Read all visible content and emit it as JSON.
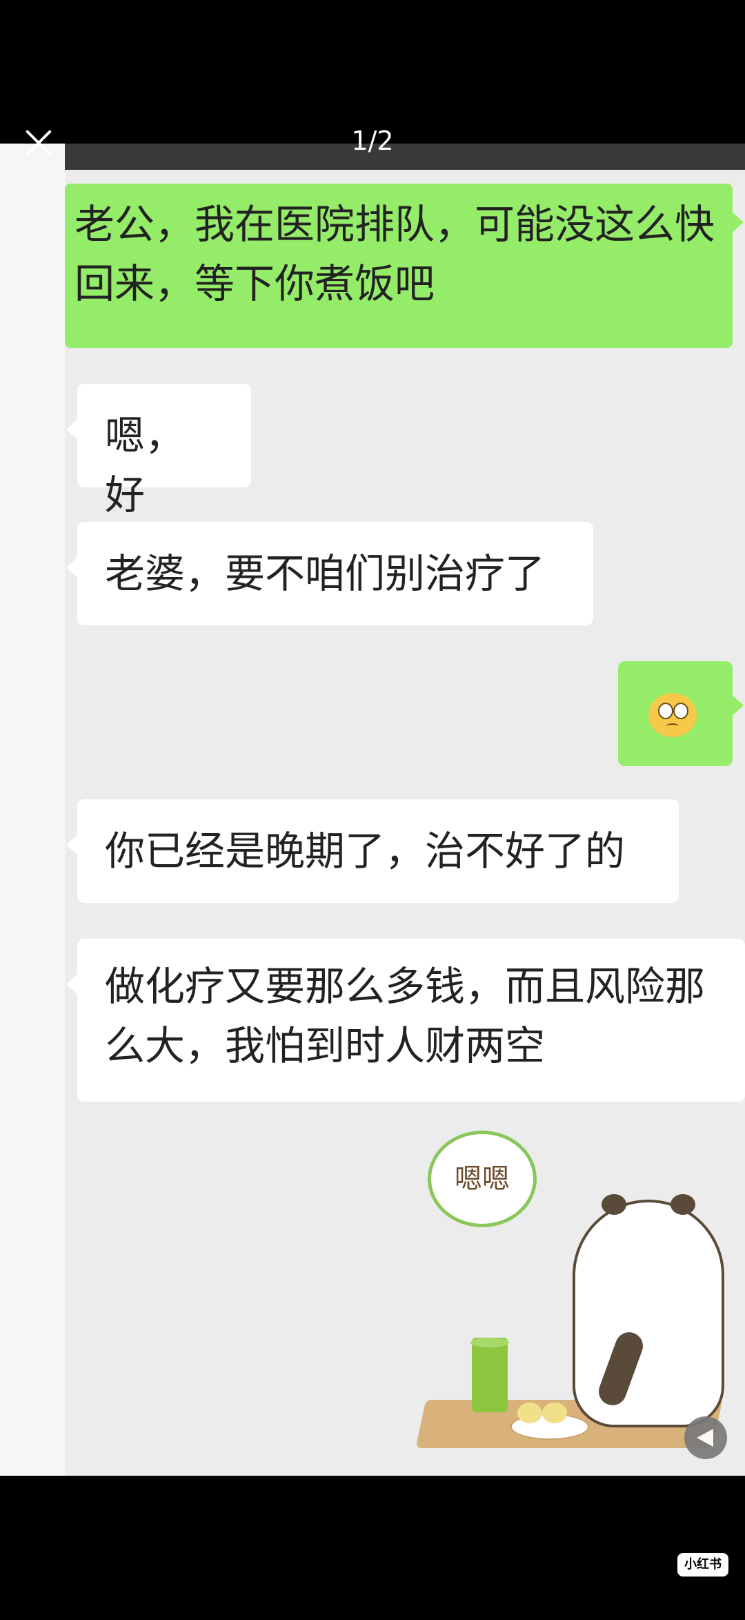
{
  "viewer": {
    "counter": "1/2"
  },
  "messages": [
    {
      "side": "right",
      "text": "老公，我在医院排队，可能没这么快回来，等下你煮饭吧"
    },
    {
      "side": "left",
      "text": "嗯，好"
    },
    {
      "side": "left",
      "text": "老婆，要不咱们别治疗了"
    },
    {
      "side": "right",
      "emoji": "worried-face-emoji"
    },
    {
      "side": "left",
      "text": "你已经是晚期了，治不好了的"
    },
    {
      "side": "left",
      "text": "做化疗又要那么多钱，而且风险那么大，我怕到时人财两空"
    }
  ],
  "sticker": {
    "speech_text": "嗯嗯",
    "icon": "panda-sticker"
  },
  "footer": {
    "brand": "小红书"
  },
  "colors": {
    "green_bubble": "#95ec69",
    "white_bubble": "#ffffff",
    "chat_bg": "#ececec"
  }
}
